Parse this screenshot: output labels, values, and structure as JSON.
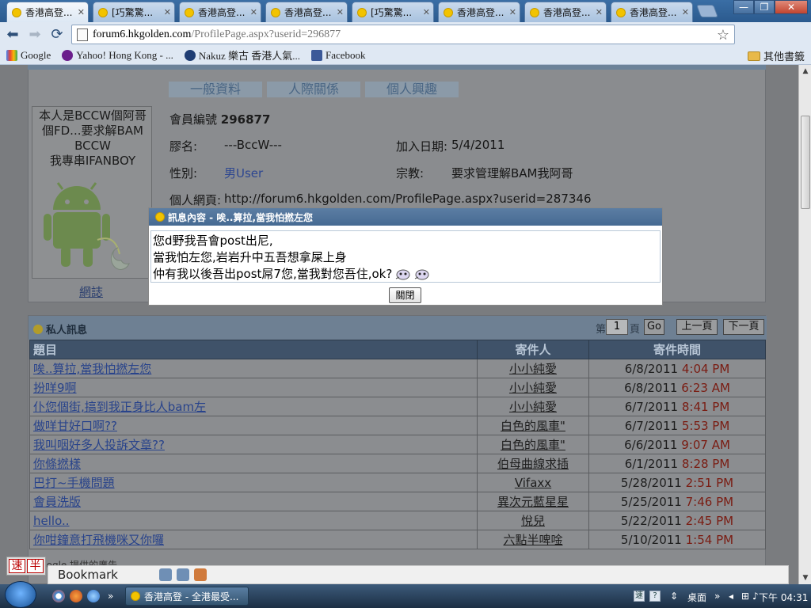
{
  "browser": {
    "tabs": [
      {
        "label": "香港高登..."
      },
      {
        "label": "[巧驚驚..."
      },
      {
        "label": "香港高登..."
      },
      {
        "label": "香港高登..."
      },
      {
        "label": "[巧驚驚..."
      },
      {
        "label": "香港高登..."
      },
      {
        "label": "香港高登..."
      },
      {
        "label": "香港高登..."
      }
    ],
    "url_host": "forum6.hkgolden.com",
    "url_path": "/ProfilePage.aspx?userid=296877",
    "bookmarks": [
      {
        "label": "Google"
      },
      {
        "label": "Yahoo! Hong Kong - ..."
      },
      {
        "label": "Nakuz 樂古 香港人氣..."
      },
      {
        "label": "Facebook"
      }
    ],
    "other_bookmarks": "其他書籤",
    "window_buttons": {
      "minimize": "—",
      "restore": "❐",
      "close": "✕"
    },
    "ext_facebook": "f",
    "ext_e": "e",
    "ext_wrench": "🔧"
  },
  "profile": {
    "tabs": [
      "一般資料",
      "人際關係",
      "個人興趣"
    ],
    "signature": [
      "本人是BCCW個阿哥",
      "個FD...要求解BAM",
      "BCCW",
      "我專串IFANBOY"
    ],
    "blog": "網誌",
    "member_no_label": "會員編號",
    "member_no": "296877",
    "nick_label": "膠名:",
    "nick": "---BccW---",
    "join_label": "加入日期:",
    "join_date": "5/4/2011",
    "gender_label": "性別:",
    "gender": "男User",
    "religion_label": "宗教:",
    "religion": "要求管理解BAM我阿哥",
    "homepage_label": "個人網頁:",
    "homepage": "http://forum6.hkgolden.com/ProfilePage.aspx?userid=287346"
  },
  "messages": {
    "section_title": "私人訊息",
    "page_prefix": "第",
    "page_value": "1",
    "page_suffix": "頁",
    "go": "Go",
    "prev": "上一頁",
    "next": "下一頁",
    "columns": {
      "subject": "題目",
      "sender": "寄件人",
      "time": "寄件時間"
    },
    "rows": [
      {
        "subject": "唉..算拉,當我怕撚左您",
        "sender": "小小純愛",
        "date": "6/8/2011",
        "time": "4:04 PM"
      },
      {
        "subject": "扮咩9啊",
        "sender": "小小純愛",
        "date": "6/8/2011",
        "time": "6:23 AM"
      },
      {
        "subject": "仆您個街,搞到我正身比人bam左",
        "sender": "小小純愛",
        "date": "6/7/2011",
        "time": "8:41 PM"
      },
      {
        "subject": "做咩甘好口啊??",
        "sender": "白色的風車\"",
        "date": "6/7/2011",
        "time": "5:53 PM"
      },
      {
        "subject": "我叫咽好多人投訴文章??",
        "sender": "白色的風車\"",
        "date": "6/6/2011",
        "time": "9:07 AM"
      },
      {
        "subject": "你條撚樣",
        "sender": "伯母曲線求插",
        "date": "6/1/2011",
        "time": "8:28 PM"
      },
      {
        "subject": "巴打~手機問題",
        "sender": "Vifaxx",
        "date": "5/28/2011",
        "time": "2:51 PM"
      },
      {
        "subject": "會員洗版",
        "sender": "異次元藍星星",
        "date": "5/25/2011",
        "time": "7:46 PM"
      },
      {
        "subject": "hello..",
        "sender": "悅兒",
        "date": "5/22/2011",
        "time": "2:45 PM"
      },
      {
        "subject": "你咁鐘意打飛機咪又你囉",
        "sender": "六點半啤唫",
        "date": "5/10/2011",
        "time": "1:54 PM"
      }
    ],
    "ad_text": "Google 提供的廣告"
  },
  "dialog": {
    "title": "訊息內容 - 唉..算拉,當我怕撚左您",
    "lines": [
      "您d野我吾會post出尼,",
      "當我怕左您,岩岩升中五吾想拿屎上身",
      "仲有我以後吾出post屌7您,當我對您吾住,ok?"
    ],
    "close": "關閉"
  },
  "ime": {
    "k1": "速",
    "k2": "半"
  },
  "bookmark_toolbar": {
    "label": "Bookmark"
  },
  "taskbar": {
    "task_label": "香港高登 - 全港最受...",
    "desktop": "桌面",
    "clock": "下午 04:31"
  },
  "colors": {
    "accent": "#466a92",
    "link": "#28438b",
    "time_red": "#7a1c12"
  }
}
